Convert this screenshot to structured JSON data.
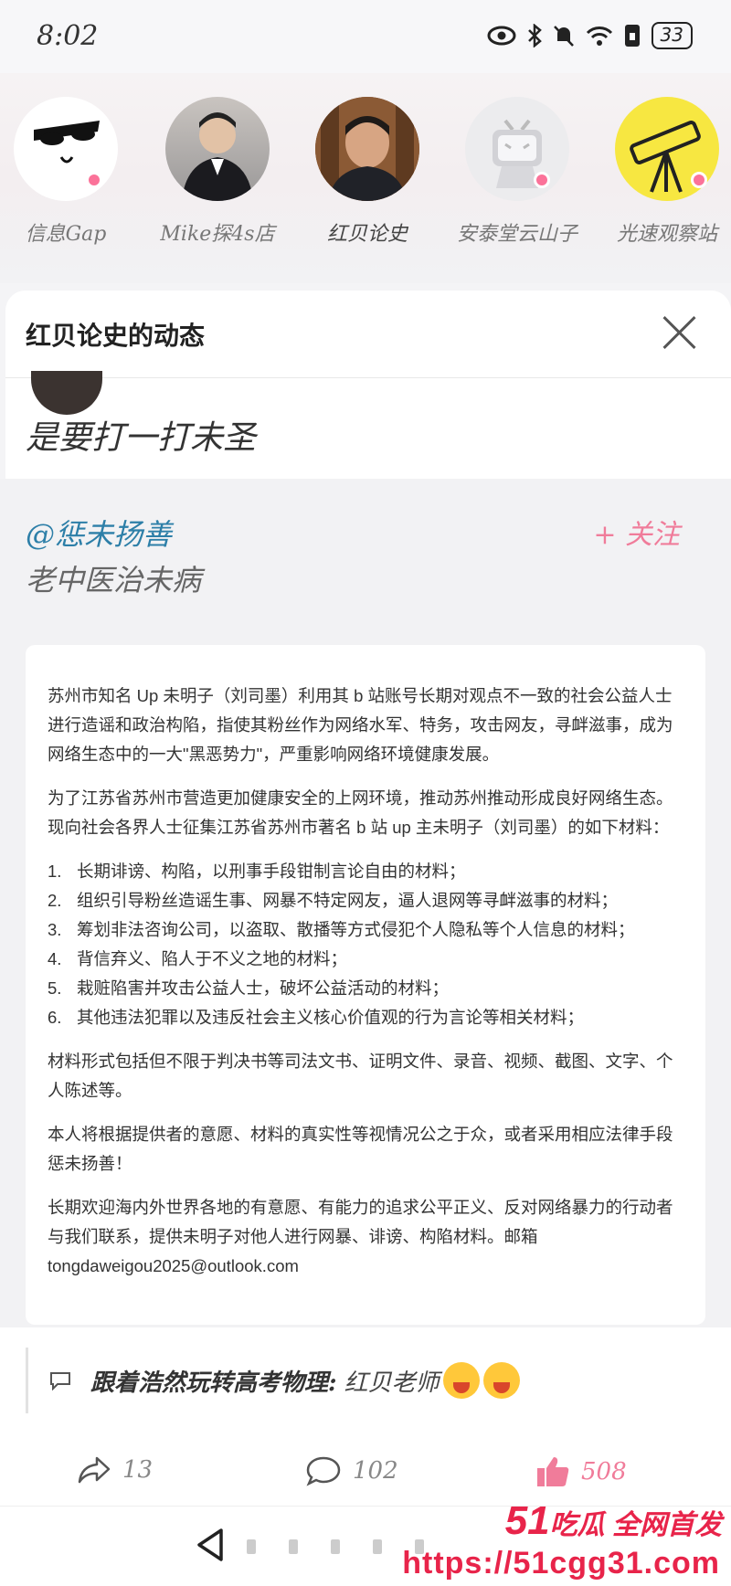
{
  "status": {
    "time": "8:02",
    "battery": "33"
  },
  "following": [
    {
      "name": "信息Gap",
      "active": false
    },
    {
      "name": "Mike探4s店",
      "active": false
    },
    {
      "name": "红贝论史",
      "active": true
    },
    {
      "name": "安泰堂云山子",
      "active": false
    },
    {
      "name": "光速观察站",
      "active": false
    }
  ],
  "panel": {
    "title": "红贝论史的动态"
  },
  "post": {
    "text": "是要打一打未圣"
  },
  "repost": {
    "mention": "@惩未扬善",
    "follow_label": "+ 关注",
    "description": "老中医治未病"
  },
  "notice": {
    "p1": "苏州市知名 Up 未明子（刘司墨）利用其 b 站账号长期对观点不一致的社会公益人士进行造谣和政治构陷，指使其粉丝作为网络水军、特务，攻击网友，寻衅滋事，成为网络生态中的一大\"黑恶势力\"，严重影响网络环境健康发展。",
    "p2": "为了江苏省苏州市营造更加健康安全的上网环境，推动苏州推动形成良好网络生态。现向社会各界人士征集江苏省苏州市著名 b 站 up 主未明子（刘司墨）的如下材料：",
    "items": [
      "长期诽谤、构陷，以刑事手段钳制言论自由的材料；",
      "组织引导粉丝造谣生事、网暴不特定网友，逼人退网等寻衅滋事的材料；",
      "筹划非法咨询公司，以盗取、散播等方式侵犯个人隐私等个人信息的材料；",
      "背信弃义、陷人于不义之地的材料；",
      "栽赃陷害并攻击公益人士，破坏公益活动的材料；",
      "其他违法犯罪以及违反社会主义核心价值观的行为言论等相关材料；"
    ],
    "p3": "材料形式包括但不限于判决书等司法文书、证明文件、录音、视频、截图、文字、个人陈述等。",
    "p4": "本人将根据提供者的意愿、材料的真实性等视情况公之于众，或者采用相应法律手段惩未扬善！",
    "p5": "长期欢迎海内外世界各地的有意愿、有能力的追求公平正义、反对网络暴力的行动者与我们联系，提供未明子对他人进行网暴、诽谤、构陷材料。邮箱",
    "email": "tongdaweigou2025@outlook.com"
  },
  "comment": {
    "user": "跟着浩然玩转高考物理:",
    "text": "红贝老师"
  },
  "actions": {
    "shares": "13",
    "comments": "102",
    "likes": "508"
  },
  "watermark": {
    "brand_num": "51",
    "brand_text": "吃瓜 全网首发",
    "url": "https://51cgg31.com"
  },
  "colors": {
    "accent_pink": "#fb7299",
    "mention_blue": "#2d7fa8",
    "watermark_red": "#e8244a"
  }
}
